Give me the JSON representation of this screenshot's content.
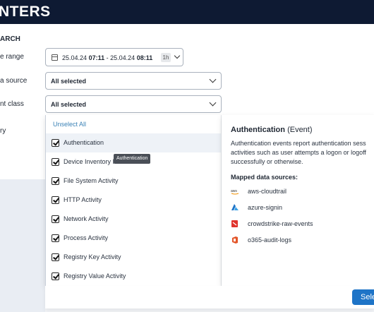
{
  "header": {
    "title": "NTERS"
  },
  "search": {
    "section_label": "ARCH",
    "labels": {
      "time_range": "e range",
      "data_source": "a source",
      "event_class": "nt class",
      "category": "ry"
    },
    "time_range": {
      "start_date": "25.04.24",
      "start_time": "07:11",
      "separator": "-",
      "end_date": "25.04.24",
      "end_time": "08:11",
      "duration_badge": "1h"
    },
    "data_source_value": "All selected",
    "event_class_value": "All selected"
  },
  "dropdown": {
    "unselect_all": "Unselect All",
    "items": [
      {
        "label": "Authentication",
        "checked": true
      },
      {
        "label": "Device Inventory Info",
        "checked": true
      },
      {
        "label": "File System Activity",
        "checked": true
      },
      {
        "label": "HTTP Activity",
        "checked": true
      },
      {
        "label": "Network Activity",
        "checked": true
      },
      {
        "label": "Process Activity",
        "checked": true
      },
      {
        "label": "Registry Key Activity",
        "checked": true
      },
      {
        "label": "Registry Value Activity",
        "checked": true
      }
    ],
    "tooltip": "Authentication"
  },
  "details": {
    "title": "Authentication",
    "title_suffix": "(Event)",
    "description": "Authentication events report authentication sess activities such as user attempts a logon or logoff successfully or otherwise.",
    "mapped_label": "Mapped data sources:",
    "sources": [
      {
        "name": "aws-cloudtrail",
        "icon": "aws-icon",
        "color": "#333333"
      },
      {
        "name": "azure-signin",
        "icon": "azure-icon",
        "color": "#1e74c7"
      },
      {
        "name": "crowdstrike-raw-events",
        "icon": "crowdstrike-icon",
        "color": "#e0332c"
      },
      {
        "name": "o365-audit-logs",
        "icon": "office-icon",
        "color": "#e3562a"
      }
    ]
  },
  "footer": {
    "select_button": "Sele"
  }
}
